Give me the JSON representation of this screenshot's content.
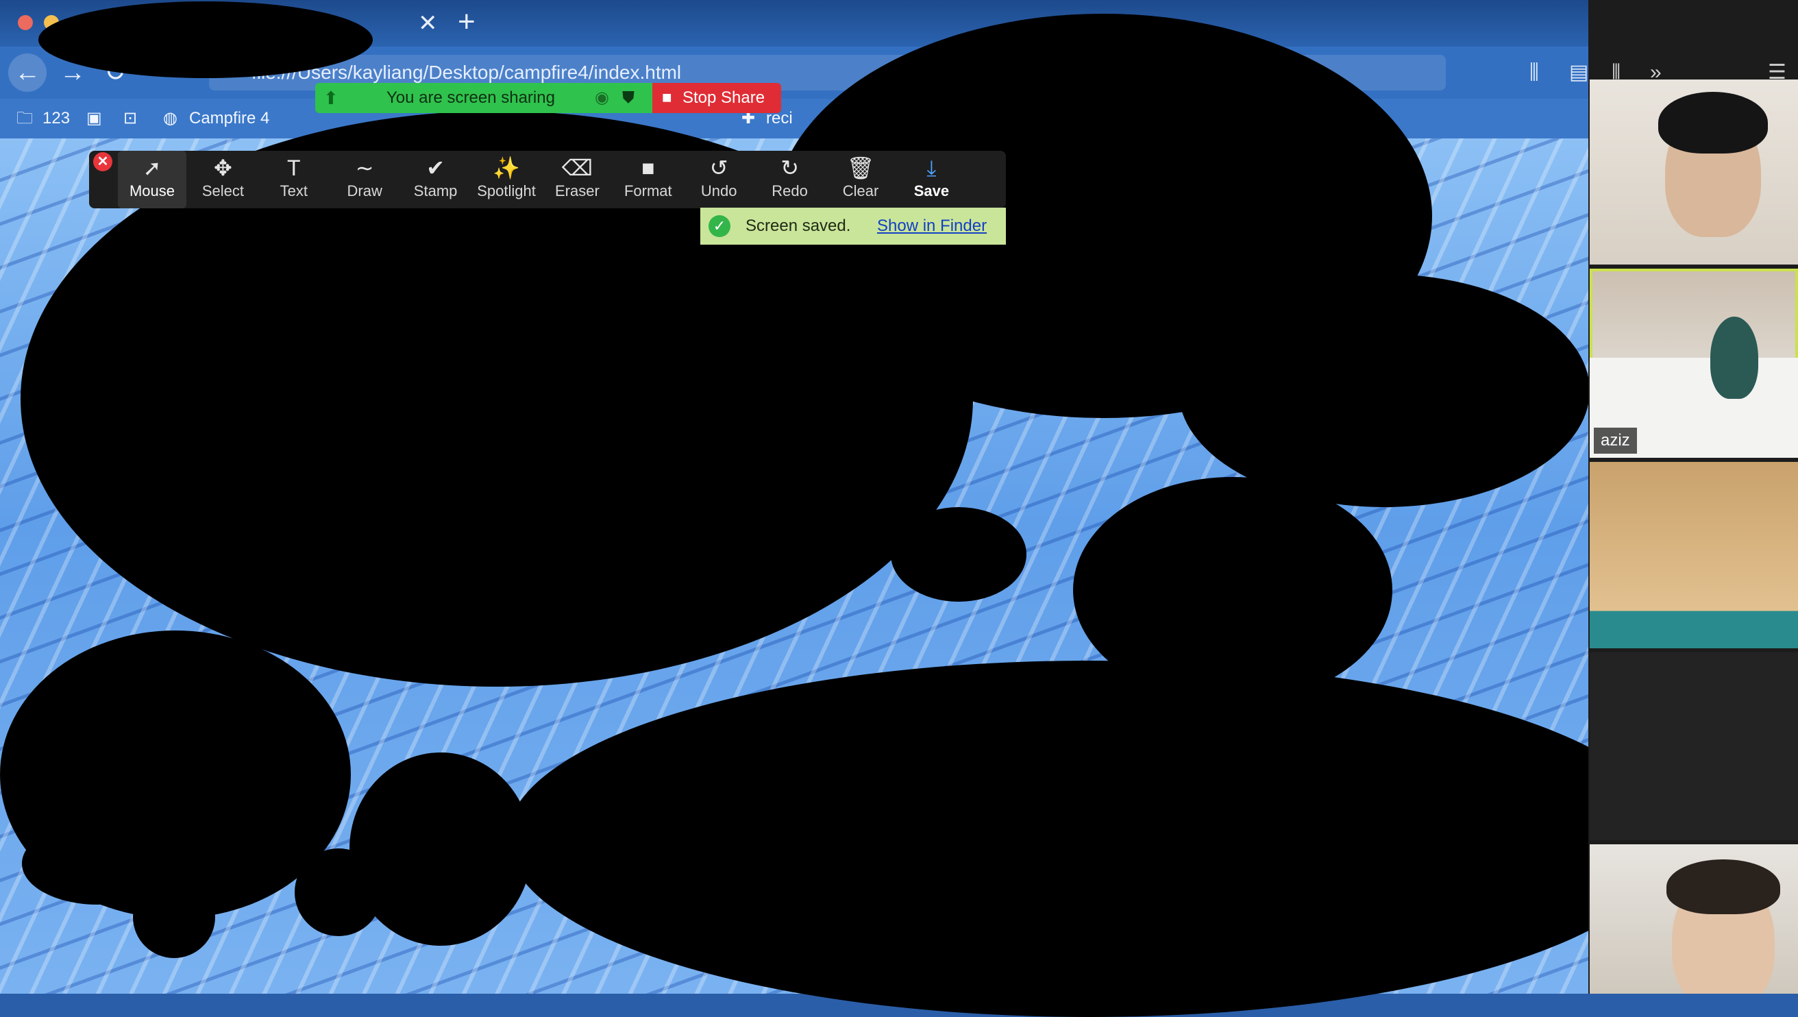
{
  "browser": {
    "tab_close": "✕",
    "tab_new": "+",
    "url": "file:///Users/kayliang/Desktop/campfire4/index.html",
    "bookmarks": [
      {
        "label": "123"
      },
      {
        "label": "Campfire 4"
      },
      {
        "label": "reci"
      }
    ]
  },
  "share_banner": {
    "status_text": "You are screen sharing",
    "stop_label": "Stop Share"
  },
  "annotation_toolbar": {
    "close": "✕",
    "tools": [
      {
        "label": "Mouse",
        "icon": "arrow-cursor-icon",
        "glyph": "➚"
      },
      {
        "label": "Select",
        "icon": "move-arrows-icon",
        "glyph": "✥"
      },
      {
        "label": "Text",
        "icon": "text-t-icon",
        "glyph": "T"
      },
      {
        "label": "Draw",
        "icon": "squiggle-icon",
        "glyph": "∼"
      },
      {
        "label": "Stamp",
        "icon": "checkmark-icon",
        "glyph": "✔"
      },
      {
        "label": "Spotlight",
        "icon": "magic-wand-icon",
        "glyph": "✨"
      },
      {
        "label": "Eraser",
        "icon": "eraser-icon",
        "glyph": "⌫"
      },
      {
        "label": "Format",
        "icon": "white-square-icon",
        "glyph": "■"
      },
      {
        "label": "Undo",
        "icon": "undo-icon",
        "glyph": "↺"
      },
      {
        "label": "Redo",
        "icon": "redo-icon",
        "glyph": "↻"
      },
      {
        "label": "Clear",
        "icon": "trash-icon",
        "glyph": "🗑"
      },
      {
        "label": "Save",
        "icon": "download-icon",
        "glyph": "⤓"
      }
    ],
    "active_tool": "Mouse"
  },
  "save_notification": {
    "message": "Screen saved.",
    "link_label": "Show in Finder"
  },
  "video_panel": {
    "participant_name": "aziz"
  },
  "colors": {
    "share_green": "#2fc24d",
    "stop_red": "#e02d35",
    "toolbar_bg": "#1e1e1e",
    "active_speaker_outline": "#cde04f",
    "saved_note_bg": "#c9e59a"
  }
}
